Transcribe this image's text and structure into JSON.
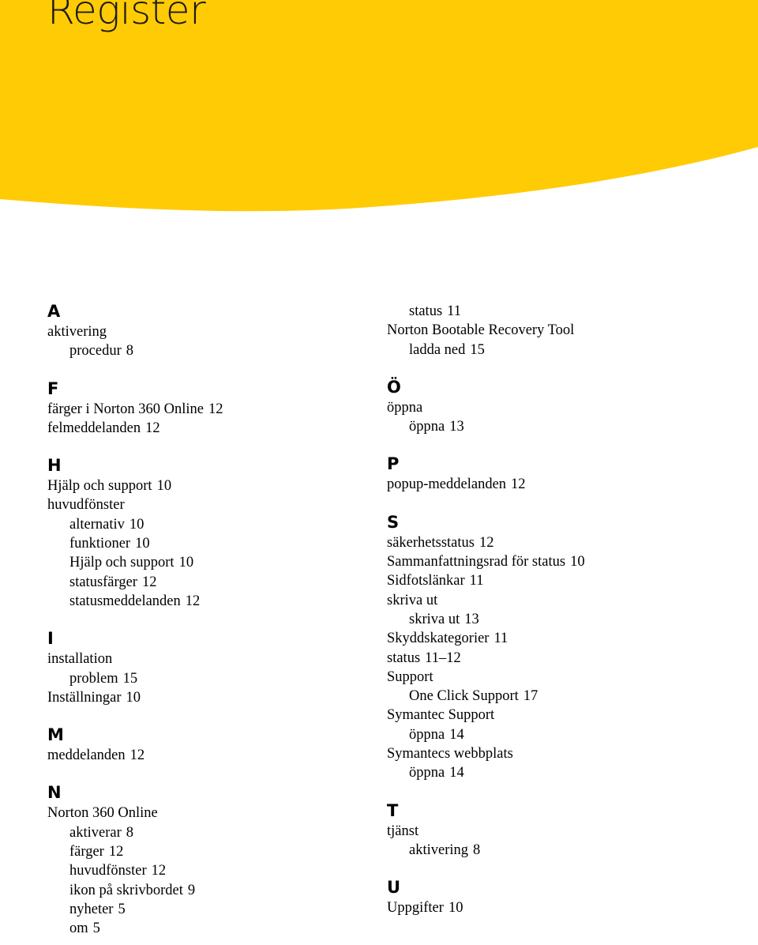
{
  "page": {
    "title": "Register",
    "banner_color": "#FFCB05",
    "background_color": "#FFFFFF",
    "text_color": "#000000"
  },
  "index": {
    "left_column": [
      {
        "letter": "A",
        "entries": [
          {
            "level": 0,
            "text": "aktivering",
            "page": ""
          },
          {
            "level": 1,
            "text": "procedur",
            "page": "8"
          }
        ]
      },
      {
        "letter": "F",
        "entries": [
          {
            "level": 0,
            "text": "färger i Norton 360 Online",
            "page": "12"
          },
          {
            "level": 0,
            "text": "felmeddelanden",
            "page": "12"
          }
        ]
      },
      {
        "letter": "H",
        "entries": [
          {
            "level": 0,
            "text": "Hjälp och support",
            "page": "10"
          },
          {
            "level": 0,
            "text": "huvudfönster",
            "page": ""
          },
          {
            "level": 1,
            "text": "alternativ",
            "page": "10"
          },
          {
            "level": 1,
            "text": "funktioner",
            "page": "10"
          },
          {
            "level": 1,
            "text": "Hjälp och support",
            "page": "10"
          },
          {
            "level": 1,
            "text": "statusfärger",
            "page": "12"
          },
          {
            "level": 1,
            "text": "statusmeddelanden",
            "page": "12"
          }
        ]
      },
      {
        "letter": "I",
        "entries": [
          {
            "level": 0,
            "text": "installation",
            "page": ""
          },
          {
            "level": 1,
            "text": "problem",
            "page": "15"
          },
          {
            "level": 0,
            "text": "Inställningar",
            "page": "10"
          }
        ]
      },
      {
        "letter": "M",
        "entries": [
          {
            "level": 0,
            "text": "meddelanden",
            "page": "12"
          }
        ]
      },
      {
        "letter": "N",
        "entries": [
          {
            "level": 0,
            "text": "Norton 360 Online",
            "page": ""
          },
          {
            "level": 1,
            "text": "aktiverar",
            "page": "8"
          },
          {
            "level": 1,
            "text": "färger",
            "page": "12"
          },
          {
            "level": 1,
            "text": "huvudfönster",
            "page": "12"
          },
          {
            "level": 1,
            "text": "ikon på skrivbordet",
            "page": "9"
          },
          {
            "level": 1,
            "text": "nyheter",
            "page": "5"
          },
          {
            "level": 1,
            "text": "om",
            "page": "5"
          }
        ]
      }
    ],
    "right_column": [
      {
        "letter": "",
        "entries": [
          {
            "level": 1,
            "text": "status",
            "page": "11"
          },
          {
            "level": 0,
            "text": "Norton Bootable Recovery Tool",
            "page": ""
          },
          {
            "level": 1,
            "text": "ladda ned",
            "page": "15"
          }
        ]
      },
      {
        "letter": "Ö",
        "entries": [
          {
            "level": 0,
            "text": "öppna",
            "page": ""
          },
          {
            "level": 1,
            "text": "öppna",
            "page": "13"
          }
        ]
      },
      {
        "letter": "P",
        "entries": [
          {
            "level": 0,
            "text": "popup-meddelanden",
            "page": "12"
          }
        ]
      },
      {
        "letter": "S",
        "entries": [
          {
            "level": 0,
            "text": "säkerhetsstatus",
            "page": "12"
          },
          {
            "level": 0,
            "text": "Sammanfattningsrad för status",
            "page": "10"
          },
          {
            "level": 0,
            "text": "Sidfotslänkar",
            "page": "11"
          },
          {
            "level": 0,
            "text": "skriva ut",
            "page": ""
          },
          {
            "level": 1,
            "text": "skriva ut",
            "page": "13"
          },
          {
            "level": 0,
            "text": "Skyddskategorier",
            "page": "11"
          },
          {
            "level": 0,
            "text": "status",
            "page": "11–12"
          },
          {
            "level": 0,
            "text": "Support",
            "page": ""
          },
          {
            "level": 1,
            "text": "One Click Support",
            "page": "17"
          },
          {
            "level": 0,
            "text": "Symantec Support",
            "page": ""
          },
          {
            "level": 1,
            "text": "öppna",
            "page": "14"
          },
          {
            "level": 0,
            "text": "Symantecs webbplats",
            "page": ""
          },
          {
            "level": 1,
            "text": "öppna",
            "page": "14"
          }
        ]
      },
      {
        "letter": "T",
        "entries": [
          {
            "level": 0,
            "text": "tjänst",
            "page": ""
          },
          {
            "level": 1,
            "text": "aktivering",
            "page": "8"
          }
        ]
      },
      {
        "letter": "U",
        "entries": [
          {
            "level": 0,
            "text": "Uppgifter",
            "page": "10"
          }
        ]
      }
    ]
  }
}
